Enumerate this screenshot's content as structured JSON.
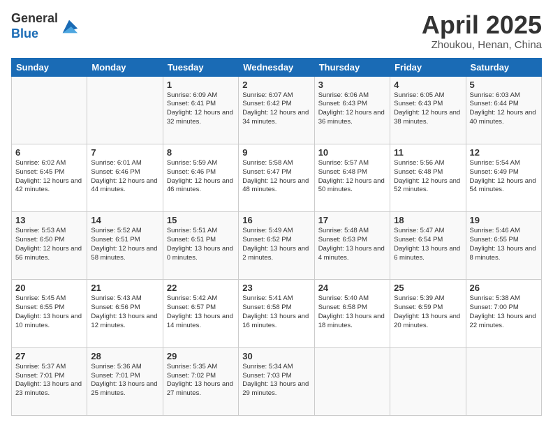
{
  "header": {
    "logo_line1": "General",
    "logo_line2": "Blue",
    "month": "April 2025",
    "location": "Zhoukou, Henan, China"
  },
  "weekdays": [
    "Sunday",
    "Monday",
    "Tuesday",
    "Wednesday",
    "Thursday",
    "Friday",
    "Saturday"
  ],
  "weeks": [
    [
      {
        "day": "",
        "sunrise": "",
        "sunset": "",
        "daylight": ""
      },
      {
        "day": "",
        "sunrise": "",
        "sunset": "",
        "daylight": ""
      },
      {
        "day": "1",
        "sunrise": "Sunrise: 6:09 AM",
        "sunset": "Sunset: 6:41 PM",
        "daylight": "Daylight: 12 hours and 32 minutes."
      },
      {
        "day": "2",
        "sunrise": "Sunrise: 6:07 AM",
        "sunset": "Sunset: 6:42 PM",
        "daylight": "Daylight: 12 hours and 34 minutes."
      },
      {
        "day": "3",
        "sunrise": "Sunrise: 6:06 AM",
        "sunset": "Sunset: 6:43 PM",
        "daylight": "Daylight: 12 hours and 36 minutes."
      },
      {
        "day": "4",
        "sunrise": "Sunrise: 6:05 AM",
        "sunset": "Sunset: 6:43 PM",
        "daylight": "Daylight: 12 hours and 38 minutes."
      },
      {
        "day": "5",
        "sunrise": "Sunrise: 6:03 AM",
        "sunset": "Sunset: 6:44 PM",
        "daylight": "Daylight: 12 hours and 40 minutes."
      }
    ],
    [
      {
        "day": "6",
        "sunrise": "Sunrise: 6:02 AM",
        "sunset": "Sunset: 6:45 PM",
        "daylight": "Daylight: 12 hours and 42 minutes."
      },
      {
        "day": "7",
        "sunrise": "Sunrise: 6:01 AM",
        "sunset": "Sunset: 6:46 PM",
        "daylight": "Daylight: 12 hours and 44 minutes."
      },
      {
        "day": "8",
        "sunrise": "Sunrise: 5:59 AM",
        "sunset": "Sunset: 6:46 PM",
        "daylight": "Daylight: 12 hours and 46 minutes."
      },
      {
        "day": "9",
        "sunrise": "Sunrise: 5:58 AM",
        "sunset": "Sunset: 6:47 PM",
        "daylight": "Daylight: 12 hours and 48 minutes."
      },
      {
        "day": "10",
        "sunrise": "Sunrise: 5:57 AM",
        "sunset": "Sunset: 6:48 PM",
        "daylight": "Daylight: 12 hours and 50 minutes."
      },
      {
        "day": "11",
        "sunrise": "Sunrise: 5:56 AM",
        "sunset": "Sunset: 6:48 PM",
        "daylight": "Daylight: 12 hours and 52 minutes."
      },
      {
        "day": "12",
        "sunrise": "Sunrise: 5:54 AM",
        "sunset": "Sunset: 6:49 PM",
        "daylight": "Daylight: 12 hours and 54 minutes."
      }
    ],
    [
      {
        "day": "13",
        "sunrise": "Sunrise: 5:53 AM",
        "sunset": "Sunset: 6:50 PM",
        "daylight": "Daylight: 12 hours and 56 minutes."
      },
      {
        "day": "14",
        "sunrise": "Sunrise: 5:52 AM",
        "sunset": "Sunset: 6:51 PM",
        "daylight": "Daylight: 12 hours and 58 minutes."
      },
      {
        "day": "15",
        "sunrise": "Sunrise: 5:51 AM",
        "sunset": "Sunset: 6:51 PM",
        "daylight": "Daylight: 13 hours and 0 minutes."
      },
      {
        "day": "16",
        "sunrise": "Sunrise: 5:49 AM",
        "sunset": "Sunset: 6:52 PM",
        "daylight": "Daylight: 13 hours and 2 minutes."
      },
      {
        "day": "17",
        "sunrise": "Sunrise: 5:48 AM",
        "sunset": "Sunset: 6:53 PM",
        "daylight": "Daylight: 13 hours and 4 minutes."
      },
      {
        "day": "18",
        "sunrise": "Sunrise: 5:47 AM",
        "sunset": "Sunset: 6:54 PM",
        "daylight": "Daylight: 13 hours and 6 minutes."
      },
      {
        "day": "19",
        "sunrise": "Sunrise: 5:46 AM",
        "sunset": "Sunset: 6:55 PM",
        "daylight": "Daylight: 13 hours and 8 minutes."
      }
    ],
    [
      {
        "day": "20",
        "sunrise": "Sunrise: 5:45 AM",
        "sunset": "Sunset: 6:55 PM",
        "daylight": "Daylight: 13 hours and 10 minutes."
      },
      {
        "day": "21",
        "sunrise": "Sunrise: 5:43 AM",
        "sunset": "Sunset: 6:56 PM",
        "daylight": "Daylight: 13 hours and 12 minutes."
      },
      {
        "day": "22",
        "sunrise": "Sunrise: 5:42 AM",
        "sunset": "Sunset: 6:57 PM",
        "daylight": "Daylight: 13 hours and 14 minutes."
      },
      {
        "day": "23",
        "sunrise": "Sunrise: 5:41 AM",
        "sunset": "Sunset: 6:58 PM",
        "daylight": "Daylight: 13 hours and 16 minutes."
      },
      {
        "day": "24",
        "sunrise": "Sunrise: 5:40 AM",
        "sunset": "Sunset: 6:58 PM",
        "daylight": "Daylight: 13 hours and 18 minutes."
      },
      {
        "day": "25",
        "sunrise": "Sunrise: 5:39 AM",
        "sunset": "Sunset: 6:59 PM",
        "daylight": "Daylight: 13 hours and 20 minutes."
      },
      {
        "day": "26",
        "sunrise": "Sunrise: 5:38 AM",
        "sunset": "Sunset: 7:00 PM",
        "daylight": "Daylight: 13 hours and 22 minutes."
      }
    ],
    [
      {
        "day": "27",
        "sunrise": "Sunrise: 5:37 AM",
        "sunset": "Sunset: 7:01 PM",
        "daylight": "Daylight: 13 hours and 23 minutes."
      },
      {
        "day": "28",
        "sunrise": "Sunrise: 5:36 AM",
        "sunset": "Sunset: 7:01 PM",
        "daylight": "Daylight: 13 hours and 25 minutes."
      },
      {
        "day": "29",
        "sunrise": "Sunrise: 5:35 AM",
        "sunset": "Sunset: 7:02 PM",
        "daylight": "Daylight: 13 hours and 27 minutes."
      },
      {
        "day": "30",
        "sunrise": "Sunrise: 5:34 AM",
        "sunset": "Sunset: 7:03 PM",
        "daylight": "Daylight: 13 hours and 29 minutes."
      },
      {
        "day": "",
        "sunrise": "",
        "sunset": "",
        "daylight": ""
      },
      {
        "day": "",
        "sunrise": "",
        "sunset": "",
        "daylight": ""
      },
      {
        "day": "",
        "sunrise": "",
        "sunset": "",
        "daylight": ""
      }
    ]
  ]
}
